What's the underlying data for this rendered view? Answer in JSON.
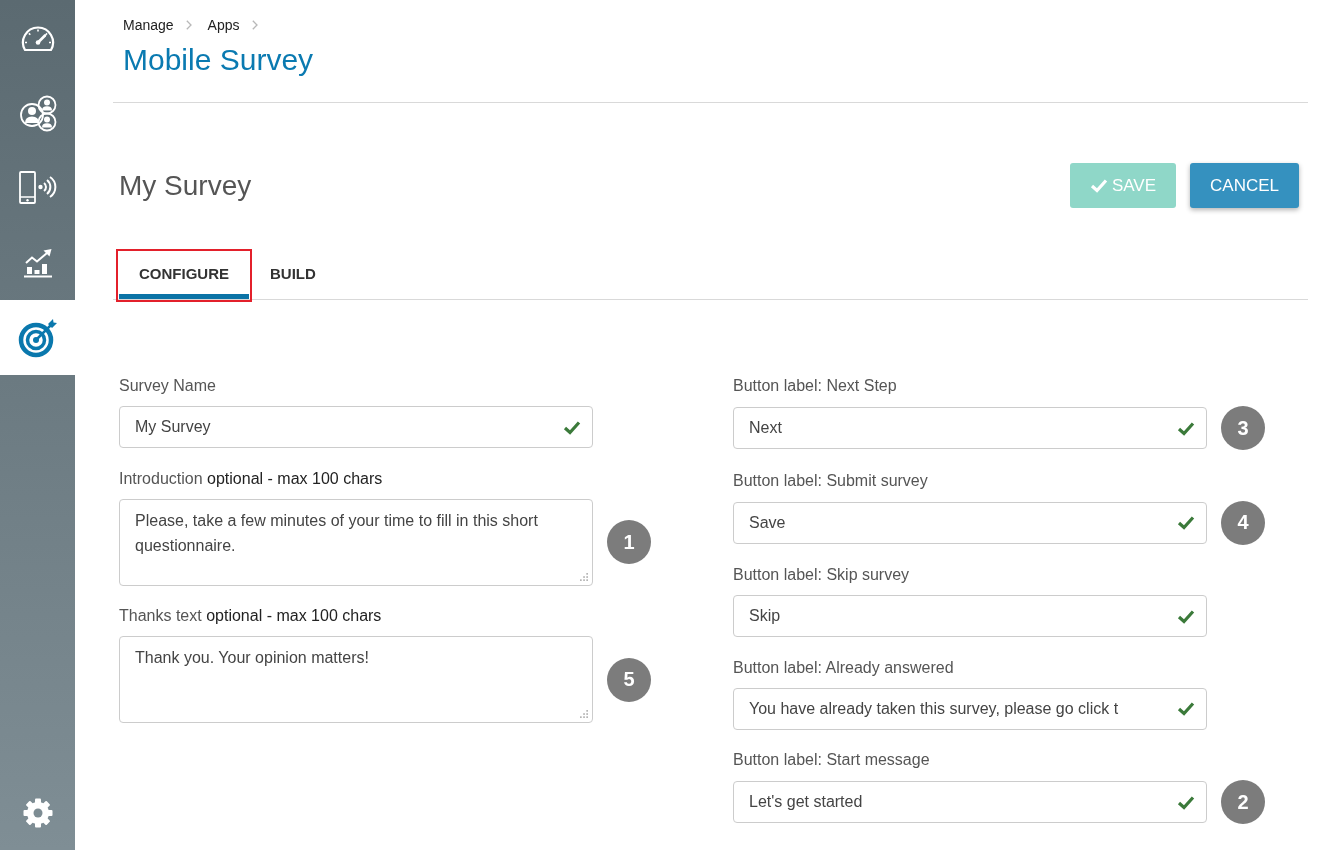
{
  "sidebar": {
    "items": [
      {
        "selected": false
      },
      {
        "selected": false
      },
      {
        "selected": false
      },
      {
        "selected": false
      },
      {
        "selected": true
      }
    ]
  },
  "breadcrumb": [
    "Manage",
    "Apps"
  ],
  "page_title": "Mobile Survey",
  "form_title": "My Survey",
  "actions": [
    {
      "kind": "save",
      "label": "SAVE",
      "disabled": true
    },
    {
      "kind": "cancel",
      "label": "CANCEL",
      "disabled": false
    }
  ],
  "tabs": [
    {
      "label": "CONFIGURE",
      "selected": true,
      "highlighted": true
    },
    {
      "label": "BUILD",
      "selected": false,
      "highlighted": false
    }
  ],
  "form": {
    "columns": [
      {
        "fields": [
          {
            "kind": "input",
            "label": "Survey Name",
            "value": "My Survey",
            "valid": true
          },
          {
            "kind": "textarea",
            "label": "Introduction",
            "hint": "optional - max 100 chars",
            "value": "Please, take a few minutes of your time to fill in this short questionnaire.",
            "valid": false,
            "badge": "1"
          },
          {
            "kind": "textarea",
            "label": "Thanks text",
            "hint": "optional - max 100 chars",
            "value": "Thank you. Your opinion matters!",
            "valid": false,
            "badge": "5"
          }
        ]
      },
      {
        "fields": [
          {
            "kind": "input",
            "label": "Button label: Next Step",
            "value": "Next",
            "valid": true,
            "badge": "3"
          },
          {
            "kind": "input",
            "label": "Button label: Submit survey",
            "value": "Save",
            "valid": true,
            "badge": "4"
          },
          {
            "kind": "input",
            "label": "Button label: Skip survey",
            "value": "Skip",
            "valid": true
          },
          {
            "kind": "input",
            "label": "Button label: Already answered",
            "value": "You have already taken this survey, please go click t",
            "valid": true
          },
          {
            "kind": "input",
            "label": "Button label: Start message",
            "value": "Let's get started",
            "valid": true,
            "badge": "2"
          }
        ]
      }
    ]
  }
}
